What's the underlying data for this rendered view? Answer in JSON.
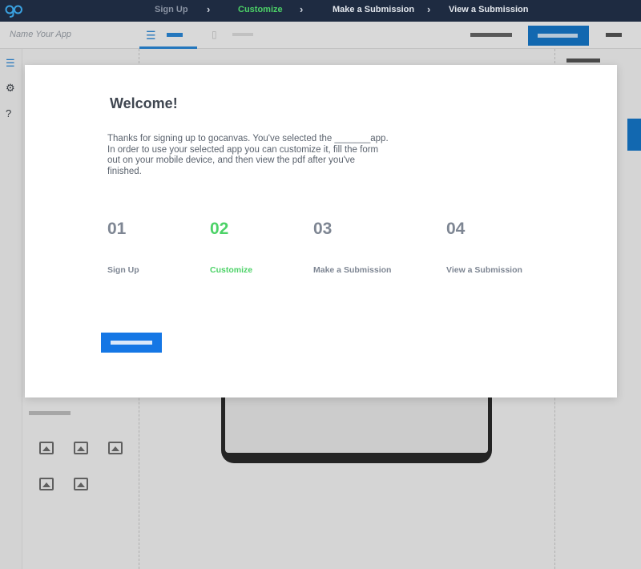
{
  "topbar": {
    "steps": [
      {
        "label": "Sign Up"
      },
      {
        "label": "Customize"
      },
      {
        "label": "Make a Submission"
      },
      {
        "label": "View a Submission"
      }
    ],
    "active_color": "#4cd267",
    "background": "#1e2b41"
  },
  "app": {
    "name_placeholder": "Name Your App"
  },
  "modal": {
    "title": "Welcome!",
    "body": "Thanks for signing up to gocanvas. You've selected the _______app. In order to use your selected app you can customize it, fill the form out on your mobile device, and then view the pdf after you've finished.",
    "steps": [
      {
        "number": "01",
        "label": "Sign Up"
      },
      {
        "number": "02",
        "label": "Customize"
      },
      {
        "number": "03",
        "label": "Make a Submission"
      },
      {
        "number": "04",
        "label": "View a Submission"
      }
    ],
    "active_step": 2,
    "button_color": "#1577e5"
  }
}
